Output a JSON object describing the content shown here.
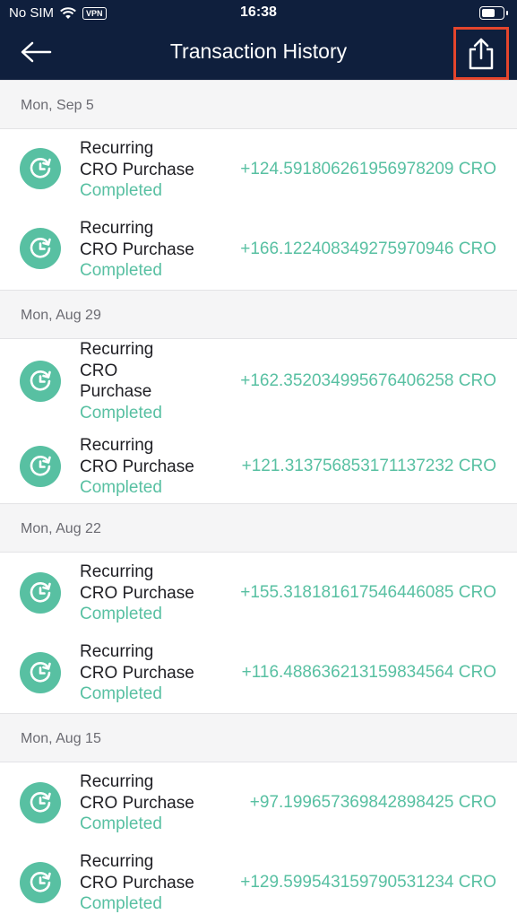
{
  "status_bar": {
    "carrier": "No SIM",
    "vpn": "VPN",
    "time": "16:38"
  },
  "header": {
    "title": "Transaction History",
    "back_icon": "arrow-left-icon",
    "share_icon": "share-export-icon",
    "highlight_color": "#e4452c",
    "bg_color": "#0f1f3d"
  },
  "accent_color": "#58c0a2",
  "groups": [
    {
      "date": "Mon, Sep 5",
      "items": [
        {
          "name_line1": "Recurring",
          "name_line2": "CRO Purchase",
          "status": "Completed",
          "amount": "+124.591806261956978209 CRO"
        },
        {
          "name_line1": "Recurring",
          "name_line2": "CRO Purchase",
          "status": "Completed",
          "amount": "+166.122408349275970946 CRO"
        }
      ]
    },
    {
      "date": "Mon, Aug 29",
      "items": [
        {
          "name_line1": "Recurring",
          "name_line2": "CRO",
          "name_line3": "Purchase",
          "status": "Completed",
          "amount": "+162.352034995676406258 CRO"
        },
        {
          "name_line1": "Recurring",
          "name_line2": "CRO Purchase",
          "status": "Completed",
          "amount": "+121.313756853171137232 CRO"
        }
      ]
    },
    {
      "date": "Mon, Aug 22",
      "items": [
        {
          "name_line1": "Recurring",
          "name_line2": "CRO Purchase",
          "status": "Completed",
          "amount": "+155.318181617546446085 CRO"
        },
        {
          "name_line1": "Recurring",
          "name_line2": "CRO Purchase",
          "status": "Completed",
          "amount": "+116.488636213159834564 CRO"
        }
      ]
    },
    {
      "date": "Mon, Aug 15",
      "items": [
        {
          "name_line1": "Recurring",
          "name_line2": "CRO Purchase",
          "status": "Completed",
          "amount": "+97.199657369842898425 CRO"
        },
        {
          "name_line1": "Recurring",
          "name_line2": "CRO Purchase",
          "status": "Completed",
          "amount": "+129.599543159790531234 CRO"
        }
      ]
    }
  ]
}
